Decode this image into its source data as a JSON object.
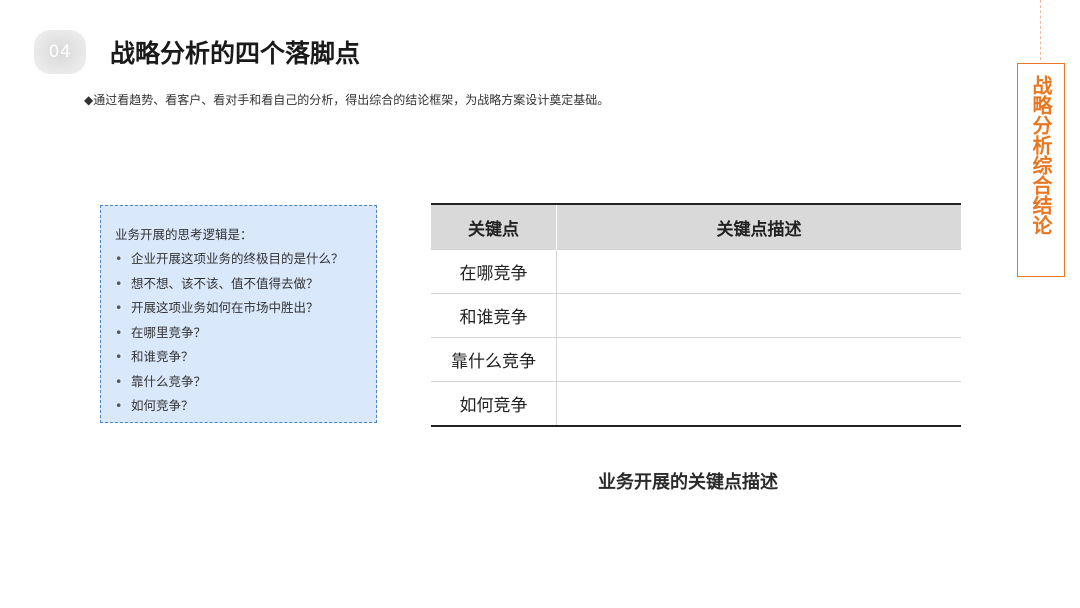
{
  "header": {
    "section_number": "04",
    "title": "战略分析的四个落脚点",
    "subtitle": "◆通过看趋势、看客户、看对手和看自己的分析，得出综合的结论框架，为战略方案设计奠定基础。"
  },
  "side_label": {
    "text": "战略分析综合结论",
    "color": "#e87722"
  },
  "logic_box": {
    "heading": "业务开展的思考逻辑是：",
    "items": [
      "企业开展这项业务的终极目的是什么？",
      "想不想、该不该、值不值得去做？",
      "开展这项业务如何在市场中胜出？",
      "在哪里竞争？",
      "和谁竞争？",
      "靠什么竞争？",
      "如何竞争？"
    ],
    "background": "#dae8fc",
    "border_color": "#4a86c8"
  },
  "table": {
    "headers": [
      "关键点",
      "关键点描述"
    ],
    "rows": [
      [
        "在哪竞争",
        ""
      ],
      [
        "和谁竞争",
        ""
      ],
      [
        "靠什么竞争",
        ""
      ],
      [
        "如何竞争",
        ""
      ]
    ],
    "caption": "业务开展的关键点描述"
  }
}
